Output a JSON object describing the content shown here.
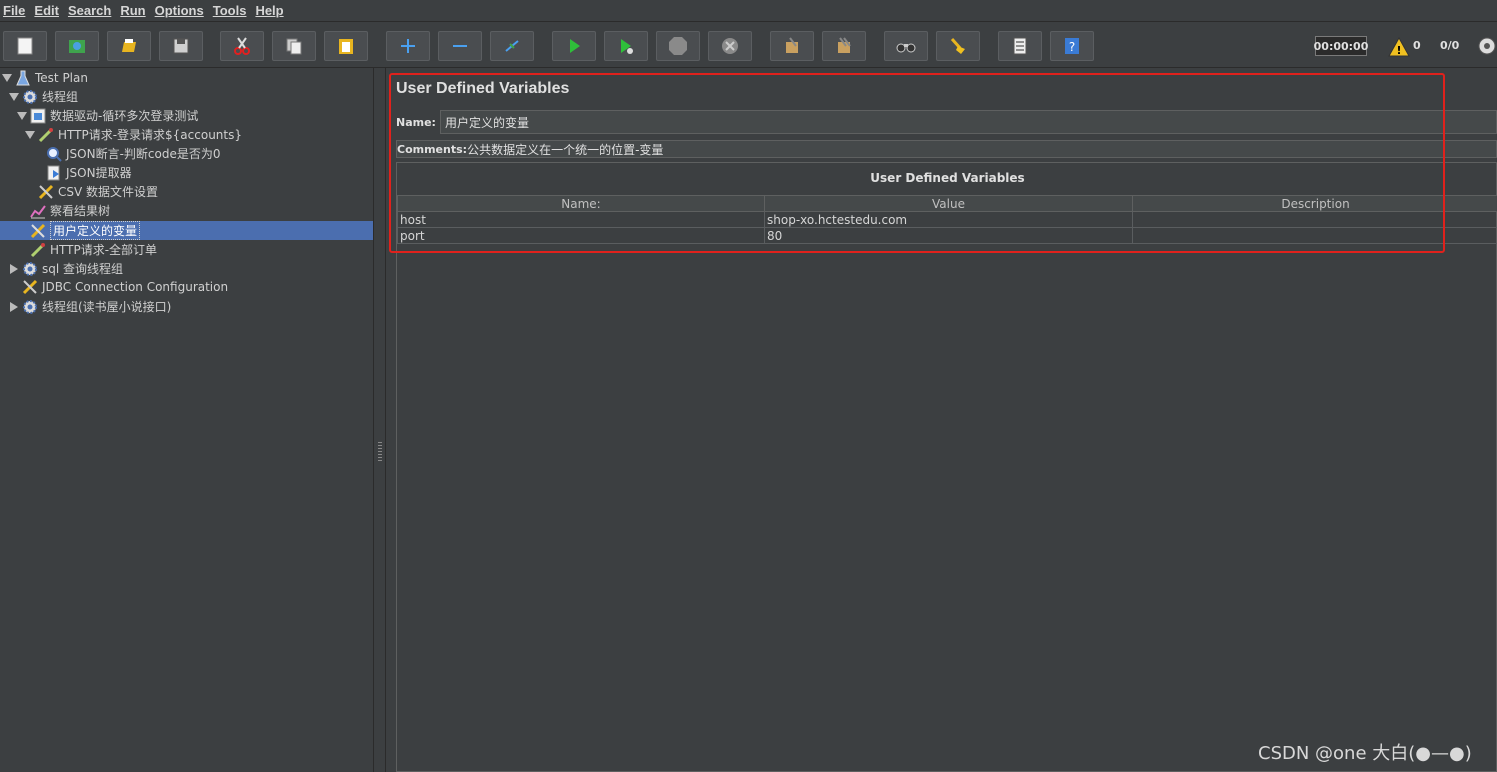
{
  "menu": [
    "File",
    "Edit",
    "Search",
    "Run",
    "Options",
    "Tools",
    "Help"
  ],
  "toolbar": {
    "buttons": [
      "new-icon",
      "templates-icon",
      "open-icon",
      "save-icon",
      "cut-icon",
      "copy-icon",
      "paste-icon",
      "expand-icon",
      "collapse-icon",
      "toggle-icon",
      "start-icon",
      "start-no-pause-icon",
      "stop-icon",
      "shutdown-icon",
      "clear-icon",
      "clear-all-icon",
      "search-icon",
      "reset-search-icon",
      "function-helper-icon",
      "help-icon"
    ],
    "timer": "00:00:00",
    "warnings": "0",
    "threads": "0/0"
  },
  "tree": {
    "items": [
      {
        "label": "Test Plan",
        "icon": "test-plan-icon"
      },
      {
        "label": "线程组",
        "icon": "gear-icon"
      },
      {
        "label": "数据驱动-循环多次登录测试",
        "icon": "controller-icon"
      },
      {
        "label": "HTTP请求-登录请求${accounts}",
        "icon": "pipette-icon"
      },
      {
        "label": "JSON断言-判断code是否为0",
        "icon": "assertion-icon"
      },
      {
        "label": "JSON提取器",
        "icon": "extractor-icon"
      },
      {
        "label": "CSV 数据文件设置",
        "icon": "config-icon"
      },
      {
        "label": "察看结果树",
        "icon": "listener-icon"
      },
      {
        "label": "用户定义的变量",
        "icon": "config-icon"
      },
      {
        "label": "HTTP请求-全部订单",
        "icon": "pipette-icon"
      },
      {
        "label": "sql 查询线程组",
        "icon": "gear-icon"
      },
      {
        "label": "JDBC Connection Configuration",
        "icon": "config-icon"
      },
      {
        "label": "线程组(读书屋小说接口)",
        "icon": "gear-icon"
      }
    ]
  },
  "panel": {
    "title": "User Defined Variables",
    "name_label": "Name:",
    "name_value": "用户定义的变量",
    "comments_label": "Comments:",
    "comments_value": "公共数据定义在一个统一的位置-变量",
    "table_title": "User Defined Variables",
    "columns": [
      "Name:",
      "Value",
      "Description"
    ],
    "rows": [
      {
        "name": "host",
        "value": "shop-xo.hctestedu.com",
        "description": ""
      },
      {
        "name": "port",
        "value": "80",
        "description": ""
      }
    ]
  },
  "colors": {
    "background": "#3c3f41",
    "selection": "#4b6eaf",
    "highlight": "#e0211c"
  },
  "watermark": "CSDN @one 大白(●—●)"
}
